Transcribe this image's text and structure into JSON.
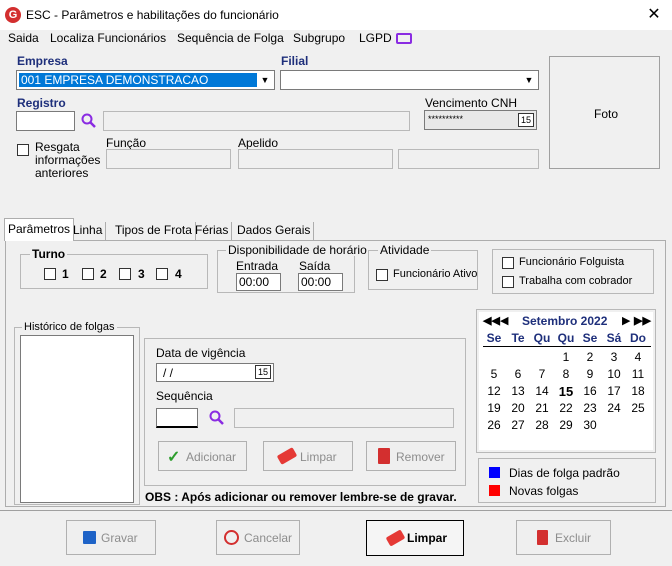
{
  "window": {
    "title": "ESC - Parâmetros e habilitações do funcionário",
    "close": "✕",
    "logo": "G"
  },
  "menu": [
    "Saida",
    "Localiza Funcionários",
    "Sequência de Folga",
    "Subgrupo",
    "LGPD"
  ],
  "header": {
    "empresa_label": "Empresa",
    "empresa_value": "001 EMPRESA DEMONSTRACAO",
    "filial_label": "Filial",
    "filial_value": "",
    "registro_label": "Registro",
    "registro_value": "",
    "vencimento_label": "Vencimento  CNH",
    "vencimento_value": "**********",
    "resgata_label_1": "Resgata",
    "resgata_label_2": "informações",
    "resgata_label_3": "anteriores",
    "funcao_label": "Função",
    "apelido_label": "Apelido",
    "foto_label": "Foto"
  },
  "tabs": [
    "Parâmetros",
    "Linha",
    "Tipos de Frota",
    "Férias",
    "Dados Gerais"
  ],
  "parametros": {
    "turno_title": "Turno",
    "turnos": [
      "1",
      "2",
      "3",
      "4"
    ],
    "disp_title": "Disponibilidade de horário",
    "entrada_label": "Entrada",
    "saida_label": "Saída",
    "entrada_value": "00:00",
    "saida_value": "00:00",
    "atividade_title": "Atividade",
    "funcionario_ativo": "Funcionário Ativo",
    "folguista": "Funcionário Folguista",
    "cobrador": "Trabalha com cobrador",
    "historico_label": "Histórico de folgas",
    "vigencia_label": "Data de vigência",
    "vigencia_value": " / /",
    "sequencia_label": "Sequência",
    "btn_adicionar": "Adicionar",
    "btn_limpar": "Limpar",
    "btn_remover": "Remover",
    "obs": "OBS : Após adicionar ou  remover lembre-se de gravar."
  },
  "calendar": {
    "month": "Setembro 2022",
    "weekdays": [
      "Se",
      "Te",
      "Qu",
      "Qu",
      "Se",
      "Sá",
      "Do"
    ],
    "weeks": [
      [
        "",
        "",
        "",
        "1",
        "2",
        "3",
        "4"
      ],
      [
        "5",
        "6",
        "7",
        "8",
        "9",
        "10",
        "11"
      ],
      [
        "12",
        "13",
        "14",
        "15",
        "16",
        "17",
        "18"
      ],
      [
        "19",
        "20",
        "21",
        "22",
        "23",
        "24",
        "25"
      ],
      [
        "26",
        "27",
        "28",
        "29",
        "30",
        "",
        ""
      ]
    ],
    "today": "15",
    "legend": [
      {
        "label": "Dias de folga padrão",
        "color": "#0000ff"
      },
      {
        "label": "Novas folgas",
        "color": "#ff0000"
      }
    ]
  },
  "footer": {
    "gravar": "Gravar",
    "cancelar": "Cancelar",
    "limpar": "Limpar",
    "excluir": "Excluir"
  }
}
